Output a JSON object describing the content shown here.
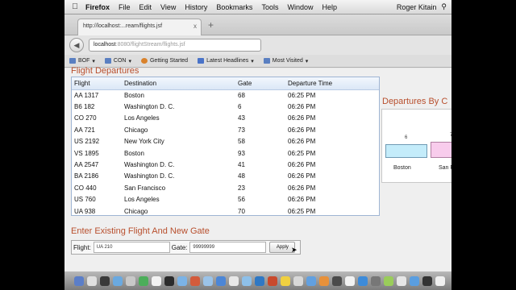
{
  "menubar": {
    "app": "Firefox",
    "menus": [
      "File",
      "Edit",
      "View",
      "History",
      "Bookmarks",
      "Tools",
      "Window",
      "Help"
    ],
    "user": "Roger Kitain"
  },
  "tab": {
    "title": "http://localhost:...ream/flights.jsf",
    "close": "x",
    "new_tab": "+"
  },
  "nav": {
    "back": "◀",
    "url_host": "localhost",
    "url_rest": ":8080/flightStream/flights.jsf"
  },
  "bookmarks": [
    "BOF",
    "CON",
    "Getting Started",
    "Latest Headlines",
    "Most Visited"
  ],
  "flights": {
    "heading": "Flight Departures",
    "columns": [
      "Flight",
      "Destination",
      "Gate",
      "Departure Time"
    ],
    "rows": [
      [
        "AA 1317",
        "Boston",
        "68",
        "06:25 PM"
      ],
      [
        "B6 182",
        "Washington D. C.",
        "6",
        "06:26 PM"
      ],
      [
        "CO 270",
        "Los Angeles",
        "43",
        "06:26 PM"
      ],
      [
        "AA 721",
        "Chicago",
        "73",
        "06:26 PM"
      ],
      [
        "US 2192",
        "New York City",
        "58",
        "06:26 PM"
      ],
      [
        "VS 1895",
        "Boston",
        "93",
        "06:25 PM"
      ],
      [
        "AA 2547",
        "Washington D. C.",
        "41",
        "06:26 PM"
      ],
      [
        "BA 2186",
        "Washington D. C.",
        "48",
        "06:26 PM"
      ],
      [
        "CO 440",
        "San Francisco",
        "23",
        "06:26 PM"
      ],
      [
        "US 760",
        "Los Angeles",
        "56",
        "06:26 PM"
      ],
      [
        "UA 938",
        "Chicago",
        "70",
        "06:25 PM"
      ]
    ]
  },
  "chart": {
    "heading": "Departures By C"
  },
  "chart_data": {
    "type": "bar",
    "categories": [
      "Boston",
      "San Fra"
    ],
    "values": [
      6,
      7
    ],
    "title": "Departures By C",
    "xlabel": "",
    "ylabel": "",
    "value_labels": [
      "6",
      "7"
    ],
    "colors": [
      "#c4ecfa",
      "#f8ccec"
    ]
  },
  "form": {
    "heading": "Enter Existing Flight And New Gate",
    "flight_label": "Flight:",
    "flight_value": "UA 210",
    "gate_label": "Gate:",
    "gate_value": "99999999",
    "apply_label": "Apply"
  },
  "dock": {
    "icon_colors": [
      "#5b7ec8",
      "#e0e0e0",
      "#3a3a3a",
      "#6aa9e0",
      "#c8c8c8",
      "#4cae5a",
      "#f2f2f2",
      "#2b2b2b",
      "#7bb3e6",
      "#d35b3b",
      "#9bc3e8",
      "#4c86d6",
      "#e8e8e8",
      "#8ec0e9",
      "#2f78c4",
      "#c94a2d",
      "#f0d040",
      "#d8d8d8",
      "#62a0e0",
      "#e8913a",
      "#4a4a4a",
      "#f2f2f2",
      "#3d8bd9",
      "#777777",
      "#9acd5a",
      "#e6e6e6",
      "#5a9ee0",
      "#333333",
      "#f0f0f0"
    ]
  }
}
